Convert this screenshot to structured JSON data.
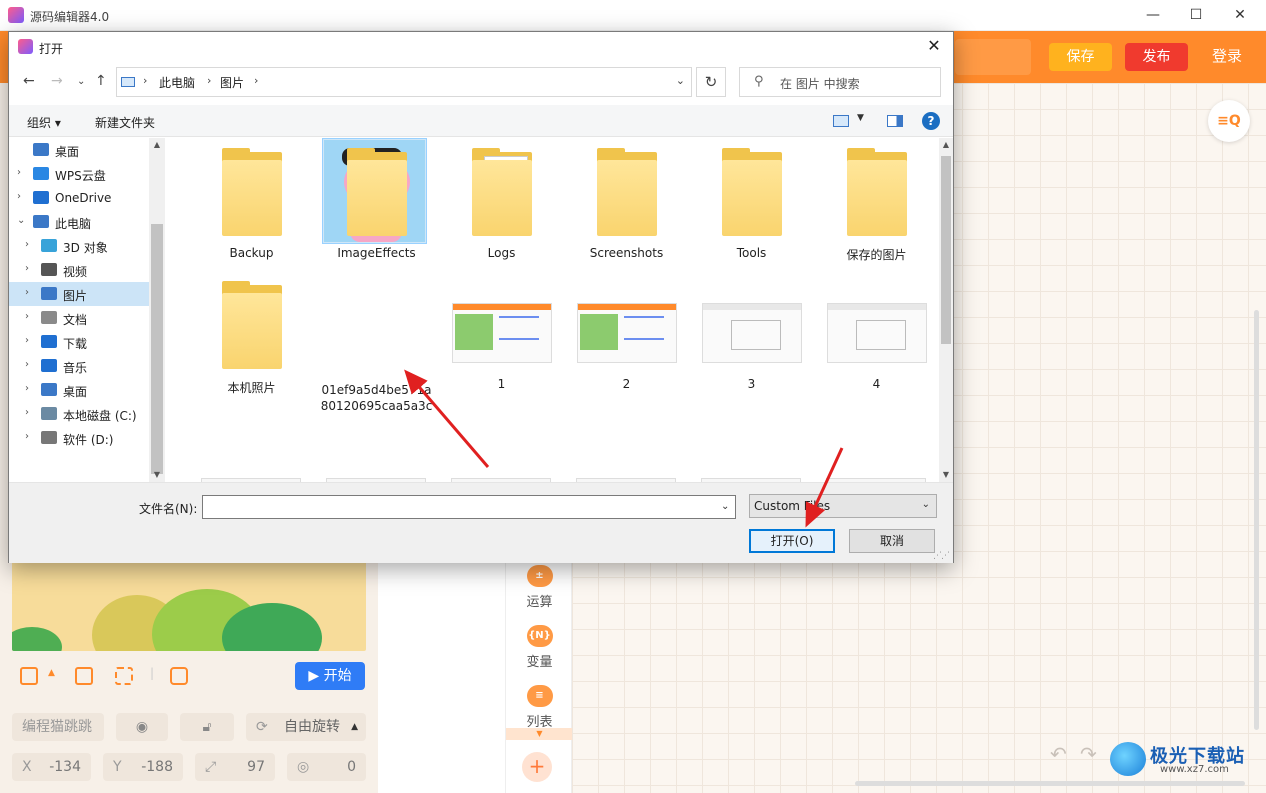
{
  "app": {
    "title": "源码编辑器4.0",
    "header": {
      "save_label": "保存",
      "publish_label": "发布",
      "login_label": "登录"
    },
    "window_controls": [
      "—",
      "☐",
      "✕"
    ],
    "palette": [
      {
        "label": "运算",
        "icon": "±"
      },
      {
        "label": "变量",
        "icon": "{N}"
      },
      {
        "label": "列表",
        "icon": "≡"
      }
    ],
    "stage": {
      "start_label": "开始"
    },
    "sprite_props": {
      "name": "编程猫跳跳",
      "rotation": "自由旋转",
      "x_label": "X",
      "x_value": "-134",
      "y_label": "Y",
      "y_value": "-188",
      "size_value": "97",
      "direction_value": "0"
    },
    "watermark": {
      "text": "极光下载站",
      "url": "www.xz7.com"
    }
  },
  "dialog": {
    "title": "打开",
    "breadcrumb": [
      "此电脑",
      "图片"
    ],
    "search_placeholder": "在 图片 中搜索",
    "commands": {
      "organize": "组织 ▾",
      "new_folder": "新建文件夹",
      "help": "?"
    },
    "tree": [
      {
        "label": "桌面",
        "icon": "desktop-icon",
        "color": "#3b78c7",
        "arrow": "",
        "indent": 0
      },
      {
        "label": "WPS云盘",
        "icon": "cloud-icon",
        "color": "#2a87e3",
        "arrow": "›",
        "indent": 0
      },
      {
        "label": "OneDrive",
        "icon": "onedrive-icon",
        "color": "#1f6fd1",
        "arrow": "›",
        "indent": 0
      },
      {
        "label": "此电脑",
        "icon": "computer-icon",
        "color": "#3b78c7",
        "arrow": "⌄",
        "indent": 0
      },
      {
        "label": "3D 对象",
        "icon": "3d-objects-icon",
        "color": "#38a3d9",
        "arrow": "›",
        "indent": 1
      },
      {
        "label": "视频",
        "icon": "video-icon",
        "color": "#555",
        "arrow": "›",
        "indent": 1
      },
      {
        "label": "图片",
        "icon": "pictures-icon",
        "color": "#3b78c7",
        "arrow": "›",
        "indent": 1,
        "selected": true
      },
      {
        "label": "文档",
        "icon": "documents-icon",
        "color": "#8a8a8a",
        "arrow": "›",
        "indent": 1
      },
      {
        "label": "下载",
        "icon": "download-icon",
        "color": "#1f6fd1",
        "arrow": "›",
        "indent": 1
      },
      {
        "label": "音乐",
        "icon": "music-icon",
        "color": "#1f6fd1",
        "arrow": "›",
        "indent": 1
      },
      {
        "label": "桌面",
        "icon": "desktop-icon",
        "color": "#3b78c7",
        "arrow": "›",
        "indent": 1
      },
      {
        "label": "本地磁盘 (C:)",
        "icon": "drive-c-icon",
        "color": "#6b8aa3",
        "arrow": "›",
        "indent": 1
      },
      {
        "label": "软件 (D:)",
        "icon": "drive-d-icon",
        "color": "#777",
        "arrow": "›",
        "indent": 1
      }
    ],
    "folders": [
      "Backup",
      "ImageEffects",
      "Logs",
      "Screenshots",
      "Tools",
      "保存的图片",
      "本机照片"
    ],
    "images": [
      {
        "label_line1": "01ef9a5d4be571a",
        "label_line2": "80120695caa5a3c",
        "kind": "pig"
      },
      {
        "label": "1",
        "kind": "app"
      },
      {
        "label": "2",
        "kind": "app"
      },
      {
        "label": "3",
        "kind": "plain"
      },
      {
        "label": "4",
        "kind": "plain"
      }
    ],
    "footer": {
      "filename_label": "文件名(N):",
      "filename_value": "",
      "filetype": "Custom Files",
      "open_label": "打开(O)",
      "cancel_label": "取消"
    }
  },
  "colors": {
    "accent": "#ff8a2b",
    "publish": "#f03a2e",
    "save": "#ffb21e",
    "selection": "#cce4f7",
    "arrow_annotation": "#e02020"
  }
}
